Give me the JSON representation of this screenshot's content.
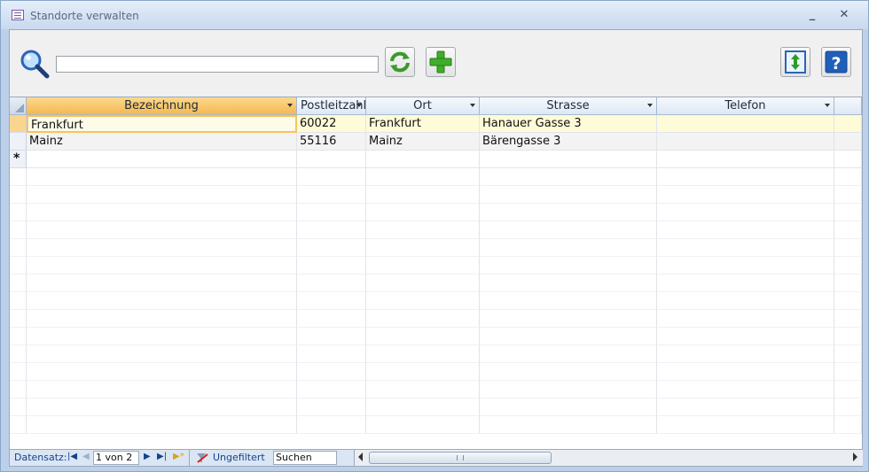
{
  "window": {
    "title": "Standorte verwalten",
    "minimize_glyph": "_",
    "close_glyph": "✕"
  },
  "toolbar": {
    "search_icon": "magnifier-icon",
    "search_placeholder": "",
    "refresh_icon": "refresh-arrows-icon",
    "add_icon": "green-plus-icon",
    "sort_icon": "up-down-arrows-icon",
    "help_icon": "question-mark-icon"
  },
  "grid": {
    "columns": [
      {
        "label": "Bezeichnung",
        "align": "center"
      },
      {
        "label": "Postleitzahl",
        "align": "left"
      },
      {
        "label": "Ort",
        "align": "center"
      },
      {
        "label": "Strasse",
        "align": "center"
      },
      {
        "label": "Telefon",
        "align": "center"
      }
    ],
    "rows": [
      {
        "bezeichnung": "Frankfurt",
        "plz": "60022",
        "ort": "Frankfurt",
        "strasse": "Hanauer Gasse 3",
        "telefon": ""
      },
      {
        "bezeichnung": "Mainz",
        "plz": "55116",
        "ort": "Mainz",
        "strasse": "Bärengasse 3",
        "telefon": ""
      }
    ],
    "new_row_marker": "*"
  },
  "statusbar": {
    "record_label": "Datensatz:",
    "record_position": "1 von 2",
    "filter_label": "Ungefiltert",
    "search_label": "Suchen"
  },
  "colors": {
    "selected_header": "#f5b74f",
    "current_row": "#fdfbd8",
    "nav_text": "#15428b"
  }
}
